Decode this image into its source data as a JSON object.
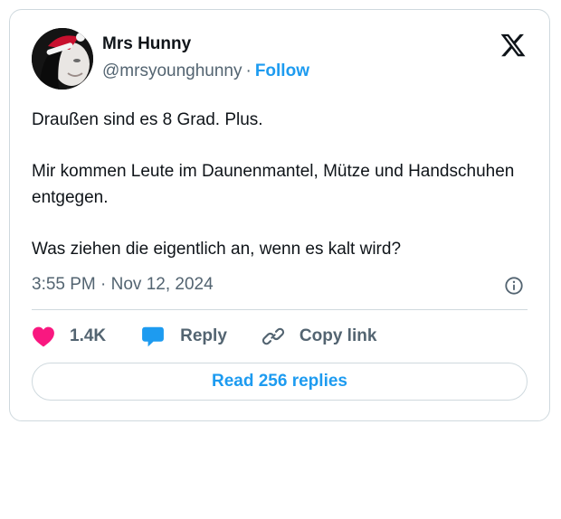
{
  "tweet": {
    "author_name": "Mrs Hunny",
    "handle": "@mrsyounghunny",
    "separator": "·",
    "follow_label": "Follow",
    "paragraphs": [
      "Draußen sind es 8 Grad. Plus.",
      "Mir kommen Leute im Daunenmantel, Mütze und Handschuhen entgegen.",
      "Was ziehen die eigentlich an, wenn es kalt wird?"
    ],
    "timestamp": "3:55 PM · Nov 12, 2024",
    "actions": {
      "like_count": "1.4K",
      "reply_label": "Reply",
      "copy_link_label": "Copy link"
    },
    "read_replies_label": "Read 256 replies"
  },
  "icons": {
    "brand": "x-logo-icon",
    "info": "info-icon",
    "like": "heart-icon",
    "reply": "speech-bubble-icon",
    "copy": "link-icon"
  },
  "colors": {
    "accent": "#1d9bf0",
    "like": "#f91880",
    "muted": "#536471",
    "text": "#0f1419",
    "border": "#cfd9de"
  }
}
